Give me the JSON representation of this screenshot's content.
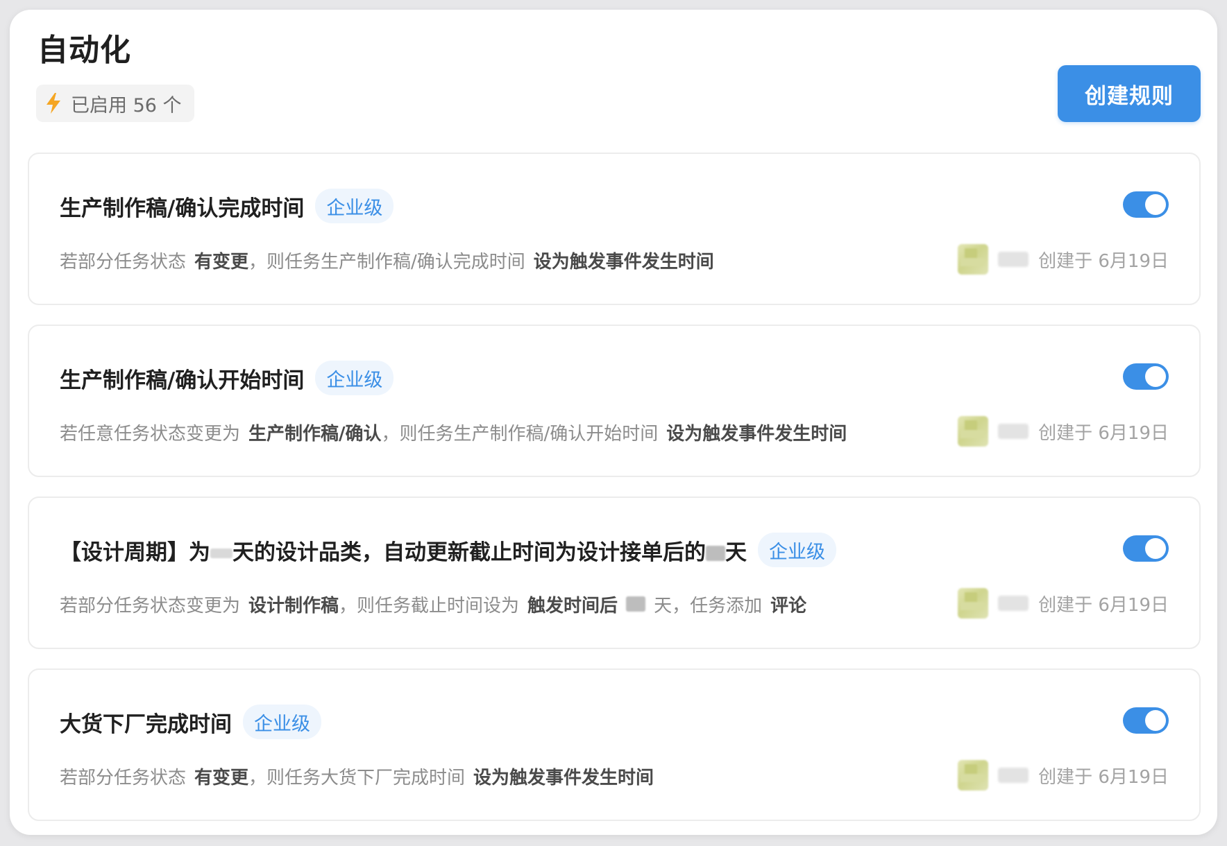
{
  "header": {
    "title": "自动化",
    "enabled_label": "已启用 56 个",
    "create_button_label": "创建规则"
  },
  "icons": {
    "enabled": "lightning-bolt-icon"
  },
  "colors": {
    "accent": "#3b8fe6",
    "bolt": "#f5a623",
    "tag_bg": "#eef5fd"
  },
  "rules": [
    {
      "title": "生产制作稿/确认完成时间",
      "tag": "企业级",
      "enabled": true,
      "desc": {
        "prefix": "若部分任务状态",
        "state": "有变更",
        "middle": "，则任务生产制作稿/确认完成时间",
        "action": "设为触发事件发生时间"
      },
      "created": "创建于 6月19日"
    },
    {
      "title": "生产制作稿/确认开始时间",
      "tag": "企业级",
      "enabled": true,
      "desc": {
        "prefix": "若任意任务状态变更为",
        "state": "生产制作稿/确认",
        "middle": "，则任务生产制作稿/确认开始时间",
        "action": "设为触发事件发生时间"
      },
      "created": "创建于 6月19日"
    },
    {
      "title_part1": "【设计周期】为",
      "title_part2": "天的设计品类，自动更新截止时间为设计接单后的",
      "title_part3": "天",
      "tag": "企业级",
      "enabled": true,
      "desc": {
        "prefix": "若部分任务状态变更为",
        "state": "设计制作稿",
        "middle": "，则任务截止时间设为",
        "action": "触发时间后",
        "unit": "天，任务添加",
        "extra": "评论"
      },
      "created": "创建于 6月19日"
    },
    {
      "title": "大货下厂完成时间",
      "tag": "企业级",
      "enabled": true,
      "desc": {
        "prefix": "若部分任务状态",
        "state": "有变更",
        "middle": "，则任务大货下厂完成时间",
        "action": "设为触发事件发生时间"
      },
      "created": "创建于 6月19日"
    }
  ]
}
